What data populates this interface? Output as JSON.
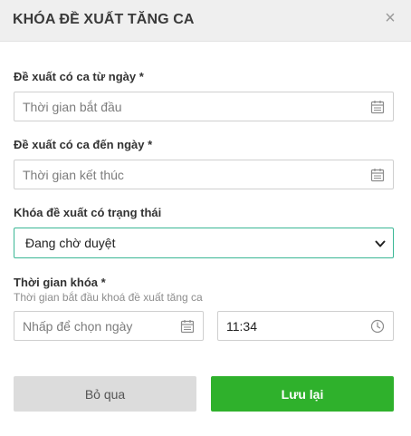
{
  "dialog": {
    "title": "KHÓA ĐỀ XUẤT TĂNG CA",
    "close_glyph": "×"
  },
  "from_date": {
    "label": "Đề xuất có ca từ ngày *",
    "placeholder": "Thời gian bắt đầu",
    "icon": "calendar-icon"
  },
  "to_date": {
    "label": "Đề xuất có ca đến ngày *",
    "placeholder": "Thời gian kết thúc",
    "icon": "calendar-icon"
  },
  "status": {
    "label": "Khóa đề xuất có trạng thái",
    "selected": "Đang chờ duyệt"
  },
  "lock_time": {
    "label": "Thời gian khóa *",
    "hint": "Thời gian bắt đầu khoá đề xuất tăng ca",
    "date_placeholder": "Nhấp để chọn ngày",
    "date_icon": "calendar-icon",
    "time_value": "11:34",
    "time_icon": "clock-icon"
  },
  "actions": {
    "cancel_label": "Bỏ qua",
    "save_label": "Lưu lại"
  },
  "colors": {
    "header_bg": "#efefef",
    "select_border": "#3ab795",
    "save_bg": "#2fb12c",
    "cancel_bg": "#dcdcdc"
  }
}
